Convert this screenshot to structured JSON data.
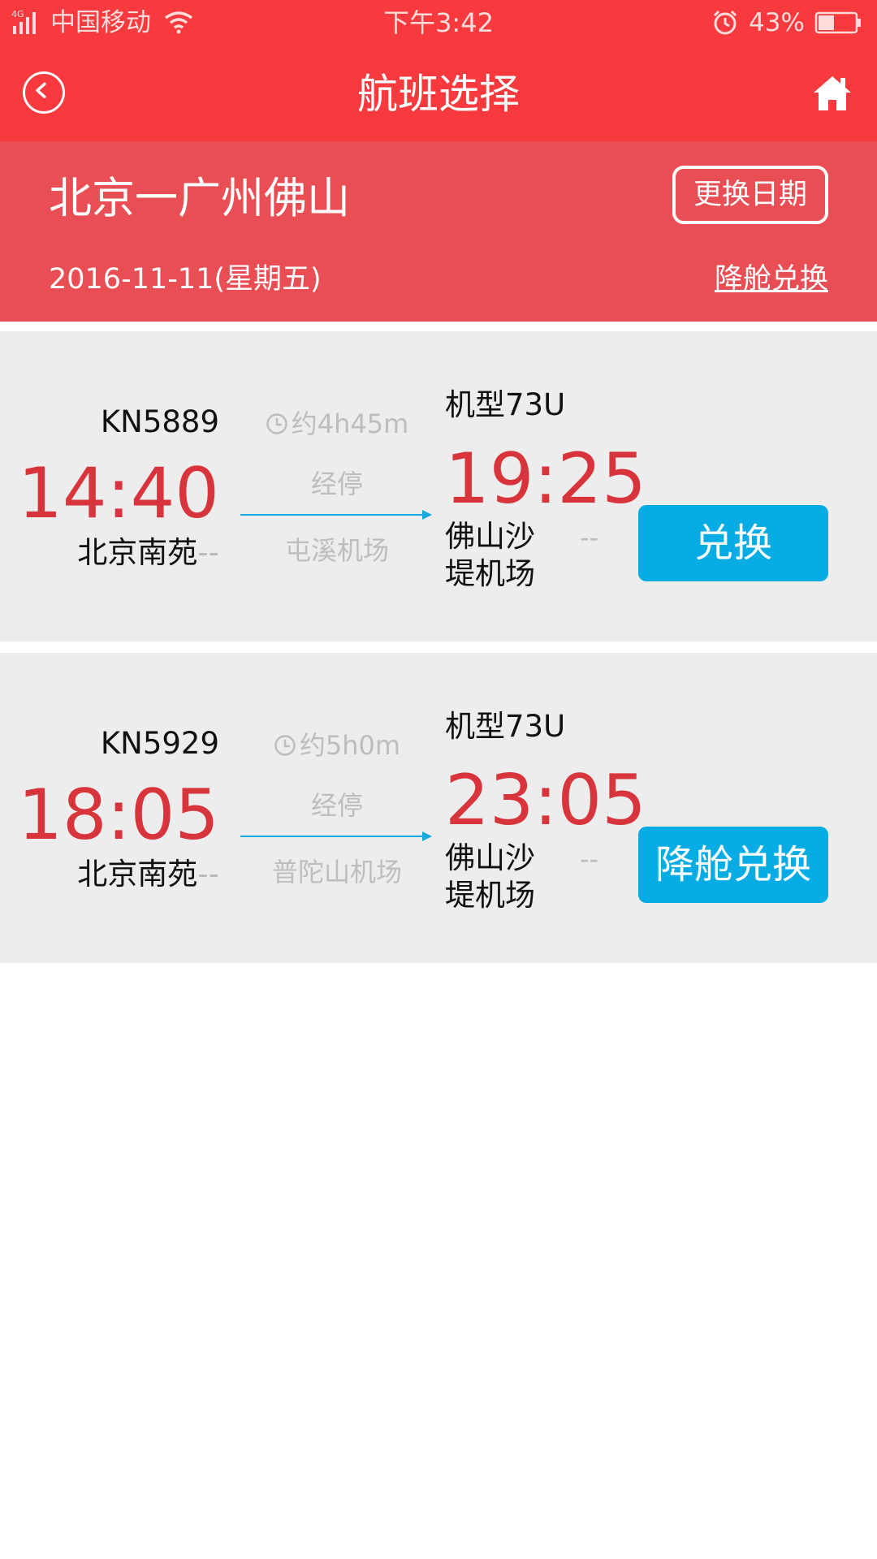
{
  "status_bar": {
    "network": "4G",
    "carrier": "中国移动",
    "time": "下午3:42",
    "battery": "43%",
    "battery_level": 0.43
  },
  "nav": {
    "title": "航班选择"
  },
  "route": {
    "cities": "北京一广州佛山",
    "change_date_label": "更换日期",
    "date": "2016-11-11(星期五)",
    "downgrade_link": "降舱兑换"
  },
  "flights": [
    {
      "flight_no": "KN5889",
      "dep_time": "14:40",
      "dep_airport": "北京南苑",
      "dep_terminal": "--",
      "duration": "约4h45m",
      "stop_label": "经停",
      "stop_airport": "屯溪机场",
      "aircraft": "机型73U",
      "arr_time": "19:25",
      "arr_airport": "佛山沙堤机场",
      "arr_terminal": "--",
      "action": "兑换"
    },
    {
      "flight_no": "KN5929",
      "dep_time": "18:05",
      "dep_airport": "北京南苑",
      "dep_terminal": "--",
      "duration": "约5h0m",
      "stop_label": "经停",
      "stop_airport": "普陀山机场",
      "aircraft": "机型73U",
      "arr_time": "23:05",
      "arr_airport": "佛山沙堤机场",
      "arr_terminal": "--",
      "action": "降舱兑换"
    }
  ],
  "colors": {
    "header_red": "#f8393d",
    "route_red": "#e94e55",
    "time_red": "#d8343c",
    "button_blue": "#07ace5",
    "card_gray": "#ededed"
  }
}
